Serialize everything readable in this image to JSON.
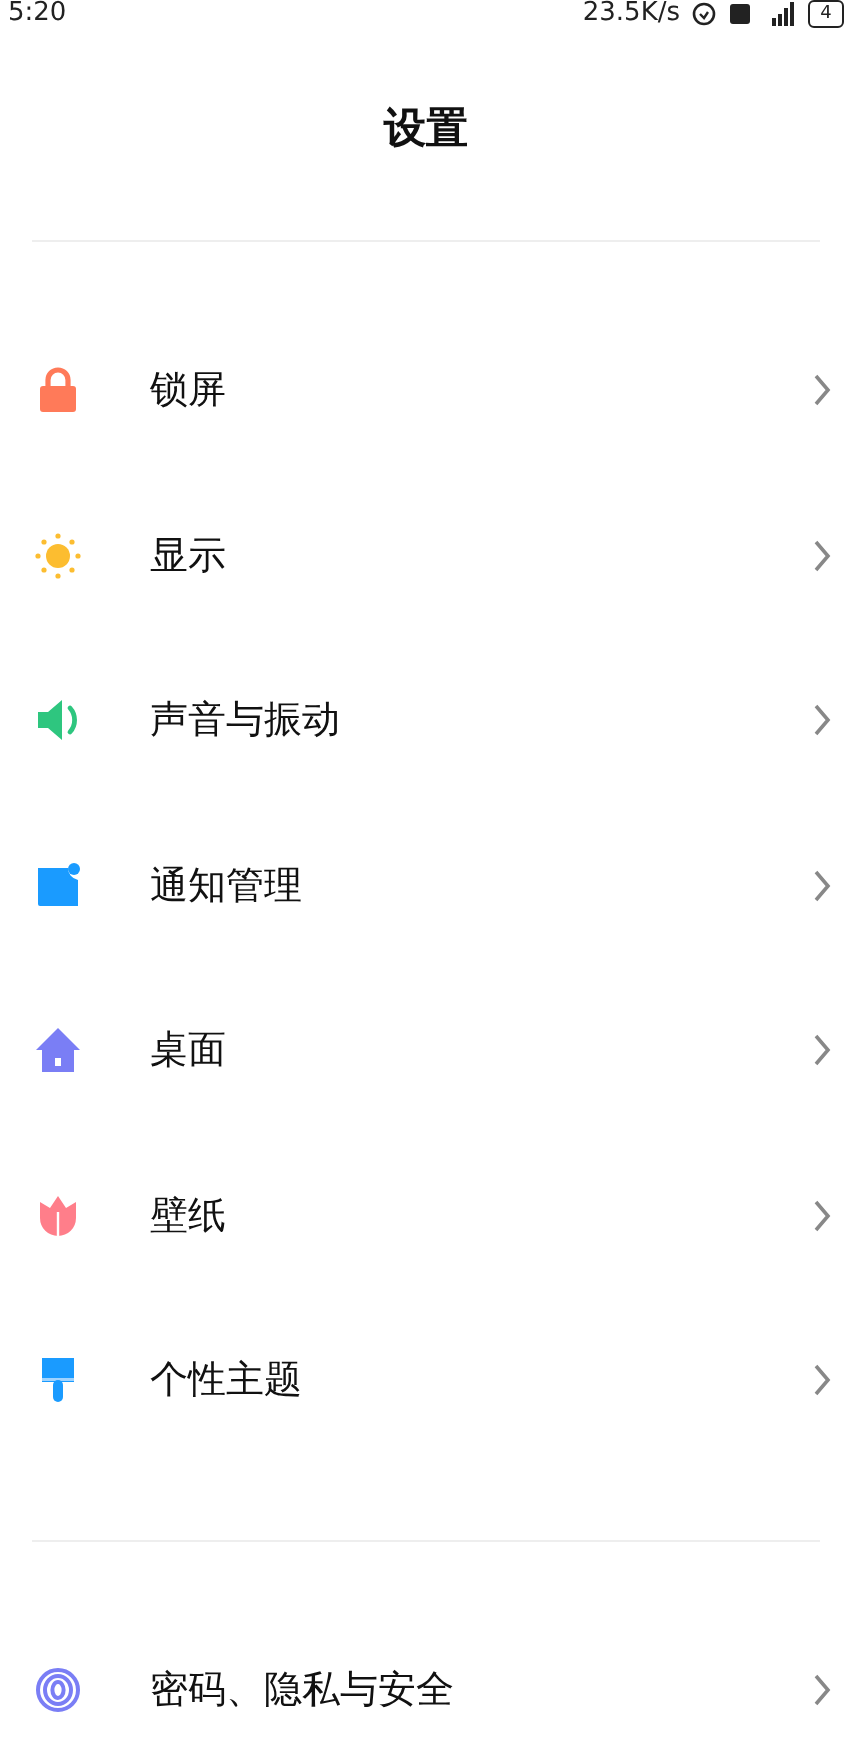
{
  "status_bar": {
    "time": "5:20",
    "net_speed": "23.5K/s",
    "battery": "4"
  },
  "title": "设置",
  "sections": [
    {
      "items": [
        {
          "label": "锁屏"
        },
        {
          "label": "显示"
        },
        {
          "label": "声音与振动"
        },
        {
          "label": "通知管理"
        },
        {
          "label": "桌面"
        },
        {
          "label": "壁纸"
        },
        {
          "label": "个性主题"
        }
      ]
    },
    {
      "items": [
        {
          "label": "密码、隐私与安全"
        }
      ]
    }
  ]
}
